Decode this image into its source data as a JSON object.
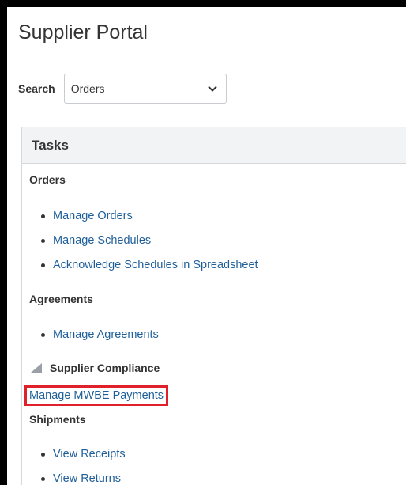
{
  "page": {
    "title": "Supplier Portal"
  },
  "search": {
    "label": "Search",
    "selected": "Orders"
  },
  "tasks": {
    "header": "Tasks",
    "orders": {
      "heading": "Orders",
      "items": [
        "Manage Orders",
        "Manage Schedules",
        "Acknowledge Schedules in Spreadsheet"
      ]
    },
    "agreements": {
      "heading": "Agreements",
      "items": [
        "Manage Agreements"
      ]
    },
    "compliance": {
      "heading": "Supplier Compliance",
      "link": "Manage MWBE Payments"
    },
    "shipments": {
      "heading": "Shipments",
      "items": [
        "View Receipts",
        "View Returns"
      ]
    }
  },
  "colors": {
    "link": "#1f5f99",
    "highlight_border": "#e0202b",
    "header_bg": "#f2f3f4"
  }
}
